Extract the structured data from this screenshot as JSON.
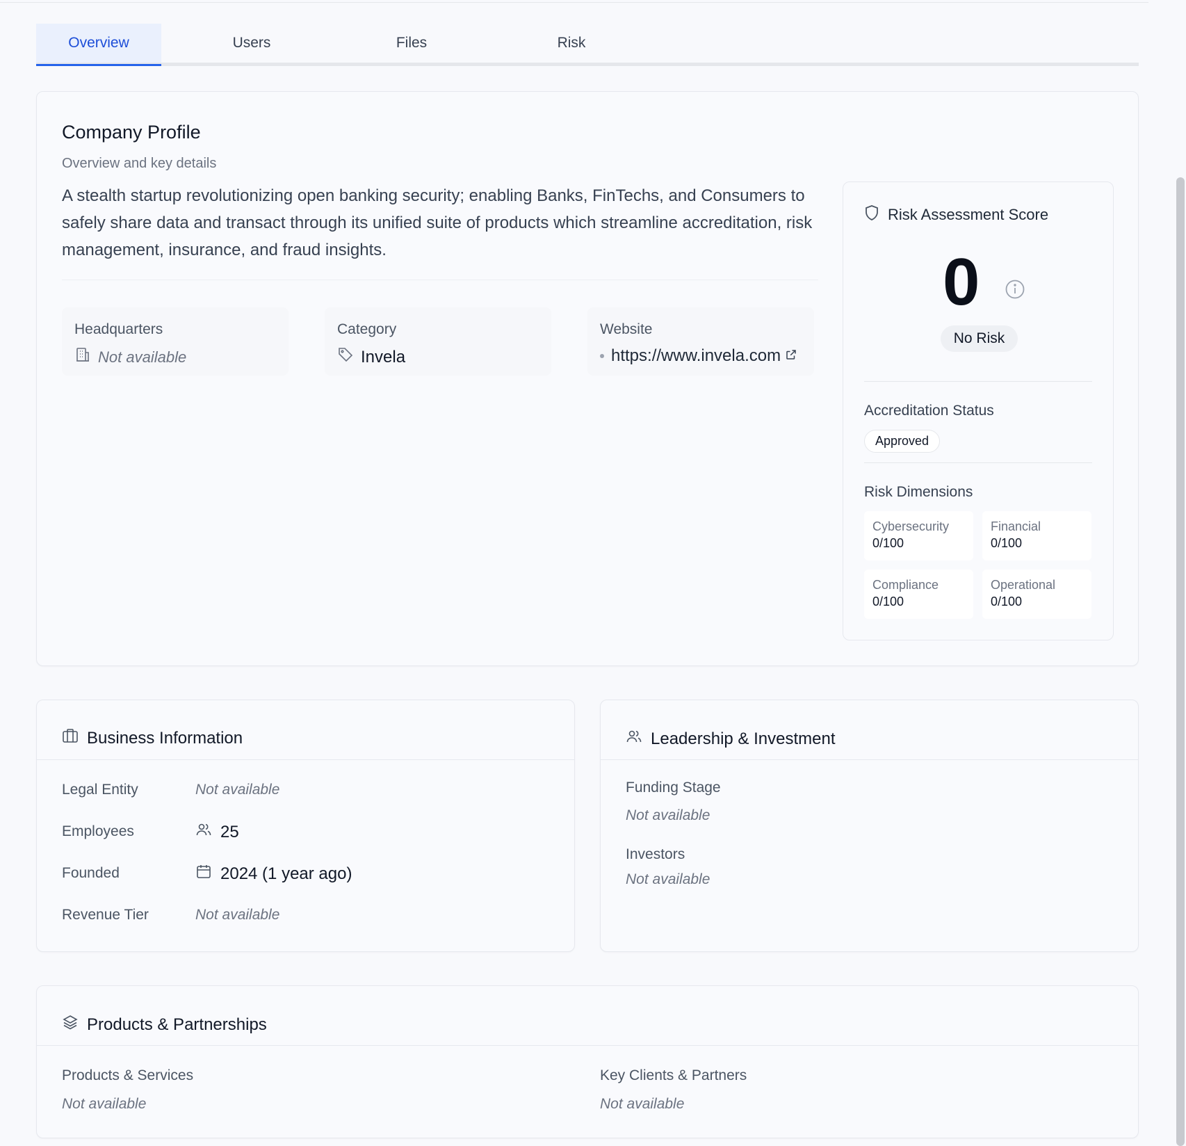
{
  "tabs": [
    {
      "label": "Overview",
      "active": true
    },
    {
      "label": "Users",
      "active": false
    },
    {
      "label": "Files",
      "active": false
    },
    {
      "label": "Risk",
      "active": false
    }
  ],
  "company_profile": {
    "title": "Company Profile",
    "subtitle": "Overview and key details",
    "description": "A stealth startup revolutionizing open banking security; enabling Banks, FinTechs, and Consumers to safely share data and transact through its unified suite of products which streamline accreditation, risk management, insurance, and fraud insights.",
    "headquarters": {
      "label": "Headquarters",
      "value": "Not available",
      "icon": "building-icon"
    },
    "category": {
      "label": "Category",
      "value": "Invela",
      "icon": "tag-icon"
    },
    "website": {
      "label": "Website",
      "value": "https://www.invela.com",
      "icon": "external-link-icon"
    }
  },
  "risk_panel": {
    "title": "Risk Assessment Score",
    "score": "0",
    "level": "No Risk",
    "accreditation_label": "Accreditation Status",
    "accreditation_status": "Approved",
    "dimensions_label": "Risk Dimensions",
    "dimensions": [
      {
        "name": "Cybersecurity",
        "value": "0/100"
      },
      {
        "name": "Financial",
        "value": "0/100"
      },
      {
        "name": "Compliance",
        "value": "0/100"
      },
      {
        "name": "Operational",
        "value": "0/100"
      }
    ]
  },
  "business_info": {
    "title": "Business Information",
    "rows": [
      {
        "label": "Legal Entity",
        "value": "Not available"
      },
      {
        "label": "Employees",
        "value": "25"
      },
      {
        "label": "Founded",
        "value": "2024 (1 year ago)"
      },
      {
        "label": "Revenue Tier",
        "value": "Not available"
      }
    ]
  },
  "leadership": {
    "title": "Leadership & Investment",
    "funding_label": "Funding Stage",
    "funding_value": "Not available",
    "investors_label": "Investors",
    "investors_value": "Not available"
  },
  "products": {
    "title": "Products & Partnerships",
    "services_label": "Products & Services",
    "services_value": "Not available",
    "clients_label": "Key Clients & Partners",
    "clients_value": "Not available"
  },
  "colors": {
    "accent": "#2563eb",
    "tab_active_bg": "#eaf0fd"
  }
}
